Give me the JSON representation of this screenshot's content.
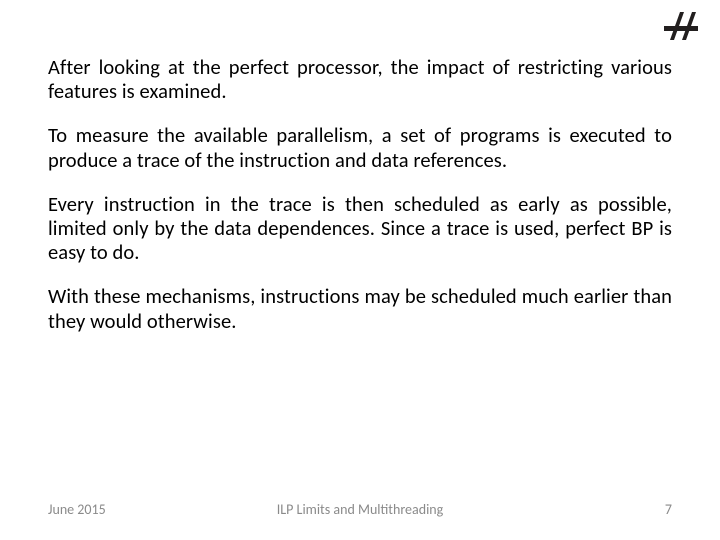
{
  "logo": {
    "alt": "Technion logo"
  },
  "paragraphs": {
    "p1": "After looking at the perfect processor, the impact of restricting various features is examined.",
    "p2": "To measure the available parallelism, a set of programs is executed to produce a trace of the instruction and data references.",
    "p3": "Every instruction in the trace is then scheduled as early as possible, limited only by the data dependences. Since a trace is used, perfect BP is easy to do.",
    "p4": "With these mechanisms, instructions may be scheduled much earlier than they would otherwise."
  },
  "footer": {
    "date": "June 2015",
    "title": "ILP Limits and Multithreading",
    "page": "7"
  }
}
